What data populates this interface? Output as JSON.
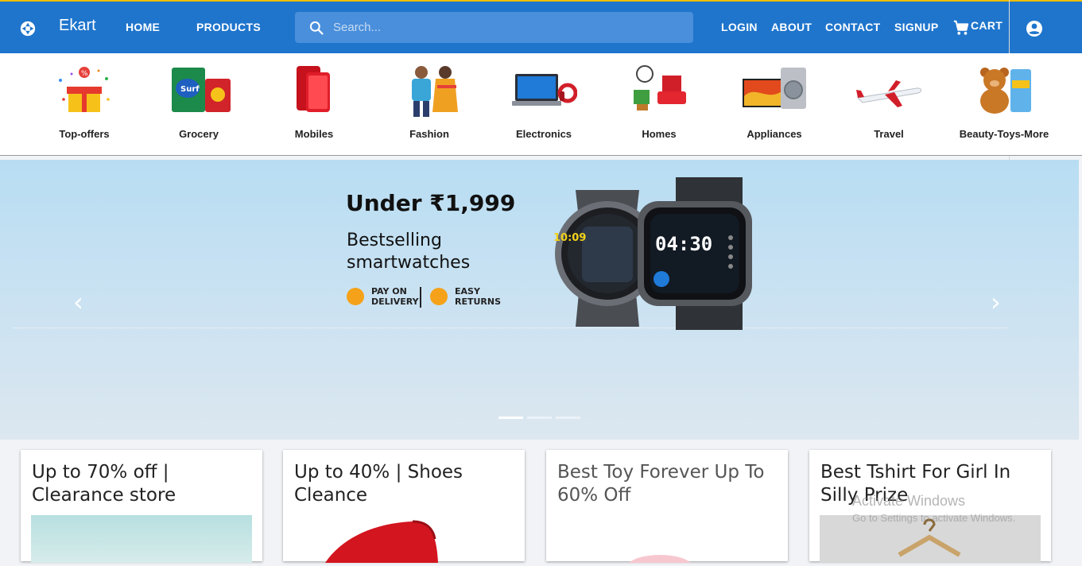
{
  "header": {
    "brand": "Ekart",
    "nav_left": [
      "HOME",
      "PRODUCTS"
    ],
    "search_placeholder": "Search...",
    "nav_right": [
      "LOGIN",
      "ABOUT",
      "CONTACT",
      "SIGNUP"
    ],
    "cart_label": "CART",
    "logo_icon": "camera-shutter-icon",
    "accent": "#1f75cc"
  },
  "categories": [
    "Top-offers",
    "Grocery",
    "Mobiles",
    "Fashion",
    "Electronics",
    "Homes",
    "Appliances",
    "Travel",
    "Beauty-Toys-More"
  ],
  "banner": {
    "headline": "Under ₹1,999",
    "subtitle": "Bestselling smartwatches",
    "badge1": "PAY ON DELIVERY",
    "badge2": "EASY RETURNS",
    "watch_time": "04:30",
    "watch_time2": "10:09",
    "slide_count": 3,
    "active_slide": 1
  },
  "cards": [
    "Up to 70% off | Clearance store",
    "Up to 40% | Shoes Cleance",
    "Best Toy Forever Up To 60% Off",
    "Best Tshirt For Girl In Silly Prize"
  ],
  "overlay": {
    "activate_title": "Activate Windows",
    "activate_sub": "Go to Settings to activate Windows."
  }
}
